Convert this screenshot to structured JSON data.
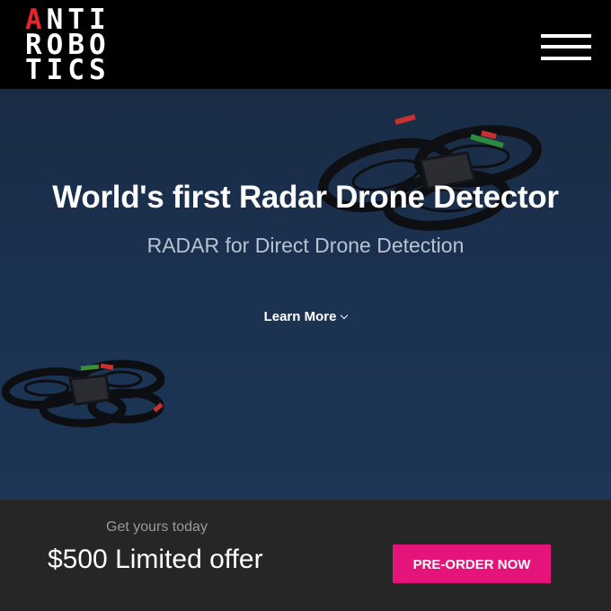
{
  "header": {
    "logo_lines": [
      "ANTI",
      "ROBO",
      "TICS"
    ],
    "menu_icon": "hamburger-menu-icon"
  },
  "hero": {
    "title": "World's first Radar Drone Detector",
    "subtitle": "RADAR for Direct Drone Detection",
    "learn_more_label": "Learn More",
    "learn_more_icon": "chevron-down-icon",
    "background_image": "quadcopter-drones-in-blue-sky"
  },
  "offer": {
    "kicker": "Get yours today",
    "title": "$500 Limited offer",
    "cta_label": "PRE-ORDER NOW"
  },
  "colors": {
    "header_bg": "#000000",
    "logo_accent": "#e8232c",
    "hero_bg": "#1b3150",
    "offer_bg": "#262626",
    "cta_bg": "#e5147a"
  }
}
